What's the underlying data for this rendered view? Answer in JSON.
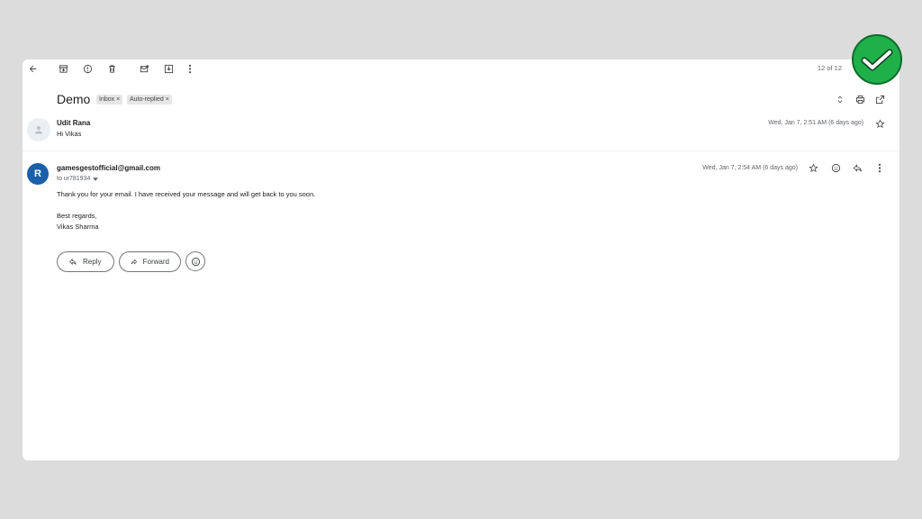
{
  "toolbar": {
    "icons": [
      "back-arrow-icon",
      "archive-icon",
      "report-spam-icon",
      "delete-icon",
      "mark-unread-icon",
      "move-to-icon",
      "more-vert-icon"
    ],
    "count": "12 of 12"
  },
  "thread": {
    "subject": "Demo",
    "labels": [
      {
        "text": "Inbox",
        "remove": "×"
      },
      {
        "text": "Auto-replied",
        "remove": "×"
      }
    ]
  },
  "messages": [
    {
      "sender": "Udit Rana",
      "snippet": "Hi Vikas",
      "date": "Wed, Jan 7, 2:51 AM (6 days ago)"
    },
    {
      "avatar_letter": "R",
      "sender": "gamesgestofficial@gmail.com",
      "to": "to ur781934",
      "date": "Wed, Jan 7, 2:54 AM (6 days ago)",
      "body": [
        "Thank you for your email. I have received your message and will get back to you soon.",
        "Best regards,",
        "Vikas Sharma"
      ]
    }
  ],
  "actions": {
    "reply": "Reply",
    "forward": "Forward"
  },
  "colors": {
    "background": "#dcdcdc",
    "avatar_blue": "#1a5fa8",
    "check_badge": "#1fb04a"
  }
}
